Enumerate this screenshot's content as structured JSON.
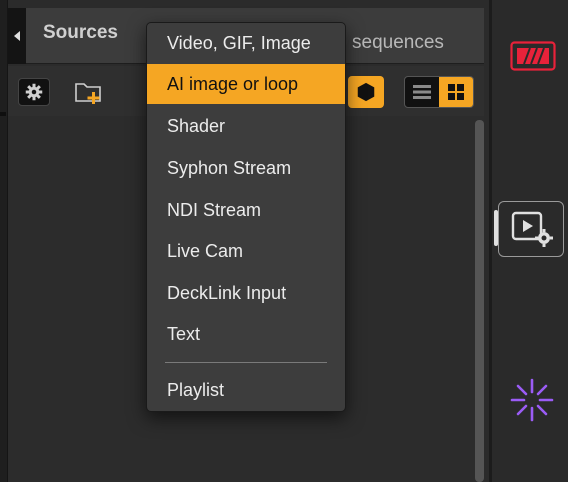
{
  "panel": {
    "tabs": [
      "Sources",
      "sequences"
    ]
  },
  "toolbar": {
    "buttons": [
      "settings",
      "add-folder",
      "hexagon-filter",
      "list-view",
      "grid-view"
    ],
    "active_view": "grid"
  },
  "source_menu": {
    "items": [
      "Video, GIF, Image",
      "AI image or loop",
      "Shader",
      "Syphon Stream",
      "NDI Stream",
      "Live Cam",
      "DeckLink Input",
      "Text",
      "Playlist"
    ],
    "highlighted": "AI image or loop"
  },
  "sidebar": {
    "buttons": [
      "record",
      "video-settings",
      "sparkle"
    ]
  },
  "colors": {
    "accent": "#f5a623",
    "record": "#e8223a",
    "sparkle": "#9b5cf6",
    "menu_bg": "#3d3d3d"
  }
}
